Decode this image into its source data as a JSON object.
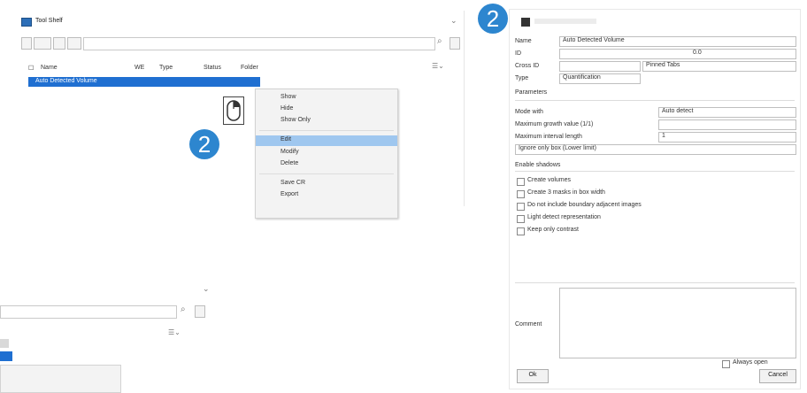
{
  "badges": {
    "top_right": "2",
    "middle": "2"
  },
  "list_window": {
    "title": "Tool Shelf",
    "columns": [
      "Name",
      "WE",
      "Type",
      "Status",
      "Folder"
    ],
    "selected_row": "Auto Detected Volume",
    "context_menu": [
      "Show",
      "Hide",
      "Show Only",
      "Edit",
      "Modify",
      "Delete",
      "Save CR",
      "Export"
    ],
    "highlighted_item": "Edit"
  },
  "dialog": {
    "fields": {
      "name_label": "Name",
      "name_value": "Auto Detected Volume",
      "id_label": "ID",
      "id_value": "0.0",
      "cross_label": "Cross ID",
      "cross_value": "Pinned Tabs",
      "type_label": "Type",
      "type_value": "Quantification"
    },
    "parameters_header": "Parameters",
    "param_mode_label": "Mode with",
    "param_mode_value": "Auto detect",
    "param_growth_label": "Maximum growth value (1/1)",
    "param_interval_label": "Maximum interval length",
    "param_interval_value": "1",
    "param_range": "Ignore only box (Lower limit)",
    "enable_label": "Enable shadows",
    "checkboxes": [
      "Create volumes",
      "Create 3 masks in box width",
      "Do not include boundary adjacent images",
      "Light detect representation",
      "Keep only contrast"
    ],
    "comment_label": "Comment",
    "always_open": "Always open",
    "ok_label": "Ok",
    "cancel_label": "Cancel"
  },
  "colors": {
    "accent": "#2d86cf",
    "selection": "#1f6fd1",
    "menu_highlight": "#9fc7ef"
  }
}
